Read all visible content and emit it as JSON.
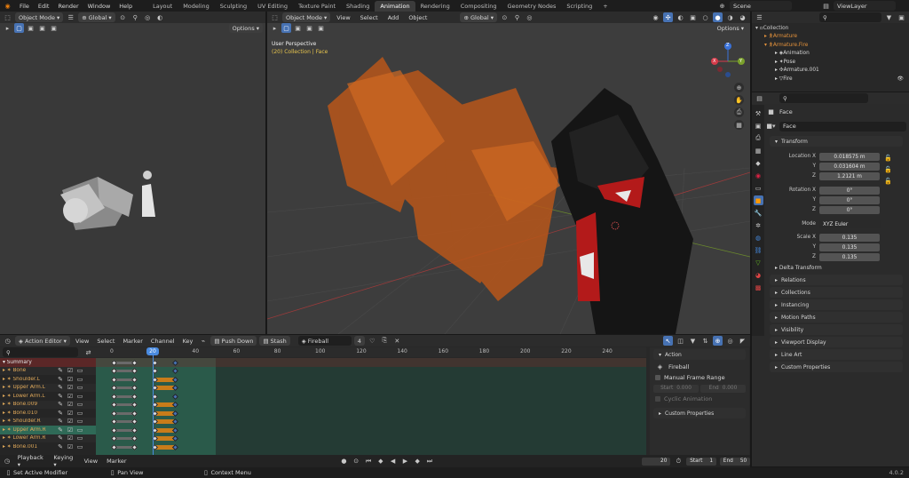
{
  "menubar": {
    "items": [
      "File",
      "Edit",
      "Render",
      "Window",
      "Help"
    ],
    "workspaces": [
      "Layout",
      "Modeling",
      "Sculpting",
      "UV Editing",
      "Texture Paint",
      "Shading",
      "Animation",
      "Rendering",
      "Compositing",
      "Geometry Nodes",
      "Scripting"
    ],
    "active_workspace": "Animation",
    "add": "+",
    "scene": "Scene",
    "view_layer": "ViewLayer"
  },
  "left_viewport": {
    "mode": "Object Mode",
    "orientation": "Global",
    "options": "Options"
  },
  "main_viewport": {
    "mode": "Object Mode",
    "menus": [
      "View",
      "Select",
      "Add",
      "Object"
    ],
    "orientation": "Global",
    "options": "Options",
    "overlay_title": "User Perspective",
    "overlay_sub": "(20) Collection | Face",
    "gizmo": {
      "x": "X",
      "y": "Y",
      "z": "Z"
    }
  },
  "outliner": {
    "items": [
      {
        "label": "Collection",
        "indent": 0
      },
      {
        "label": "Armature",
        "indent": 1
      },
      {
        "label": "Armature.Fire",
        "indent": 1
      },
      {
        "label": "Animation",
        "indent": 2
      },
      {
        "label": "Pose",
        "indent": 2
      },
      {
        "label": "Armature.001",
        "indent": 2
      },
      {
        "label": "Fire",
        "indent": 2
      }
    ]
  },
  "properties": {
    "object_name": "Face",
    "data_name": "Face",
    "transform": {
      "title": "Transform",
      "location": {
        "label": "Location X",
        "x": "0.018575 m",
        "y": "0.031604 m",
        "z": "1.2121 m"
      },
      "rotation": {
        "label": "Rotation X",
        "x": "0°",
        "y": "0°",
        "z": "0°"
      },
      "mode": {
        "label": "Mode",
        "value": "XYZ Euler"
      },
      "scale": {
        "label": "Scale X",
        "x": "0.135",
        "y": "0.135",
        "z": "0.135"
      },
      "y_label": "Y",
      "z_label": "Z",
      "delta": "Delta Transform"
    },
    "panels": [
      "Relations",
      "Collections",
      "Instancing",
      "Motion Paths",
      "Visibility",
      "Viewport Display",
      "Line Art",
      "Custom Properties"
    ],
    "version": "4.0.2"
  },
  "action_editor": {
    "mode": "Action Editor",
    "menus": [
      "View",
      "Select",
      "Marker",
      "Channel",
      "Key"
    ],
    "push_down": "Push Down",
    "stash": "Stash",
    "action_name": "Fireball",
    "users": "4",
    "frame_numbers": [
      "0",
      "20",
      "40",
      "60",
      "80",
      "100",
      "120",
      "140",
      "160",
      "180",
      "200",
      "220",
      "240"
    ],
    "current_frame": "20",
    "channels": [
      "Summary",
      "Bone",
      "Shoulder.L",
      "Upper Arm.L",
      "Lower Arm.L",
      "Bone.009",
      "Bone.010",
      "Shoulder.R",
      "Upper Arm.R",
      "Lower Arm.R",
      "Bone.001"
    ],
    "side": {
      "title": "Action",
      "action": "Fireball",
      "manual_range": "Manual Frame Range",
      "start_label": "Start",
      "start": "0.000",
      "end_label": "End",
      "end": "0.000",
      "cyclic": "Cyclic Animation",
      "custom": "Custom Properties"
    }
  },
  "timeline": {
    "menus": [
      "Playback",
      "Keying",
      "View",
      "Marker"
    ],
    "frame": "20",
    "start_label": "Start",
    "start": "1",
    "end_label": "End",
    "end": "50"
  },
  "status": {
    "items": [
      "Set Active Modifier",
      "Pan View",
      "Context Menu"
    ],
    "version": "4.0.2"
  }
}
